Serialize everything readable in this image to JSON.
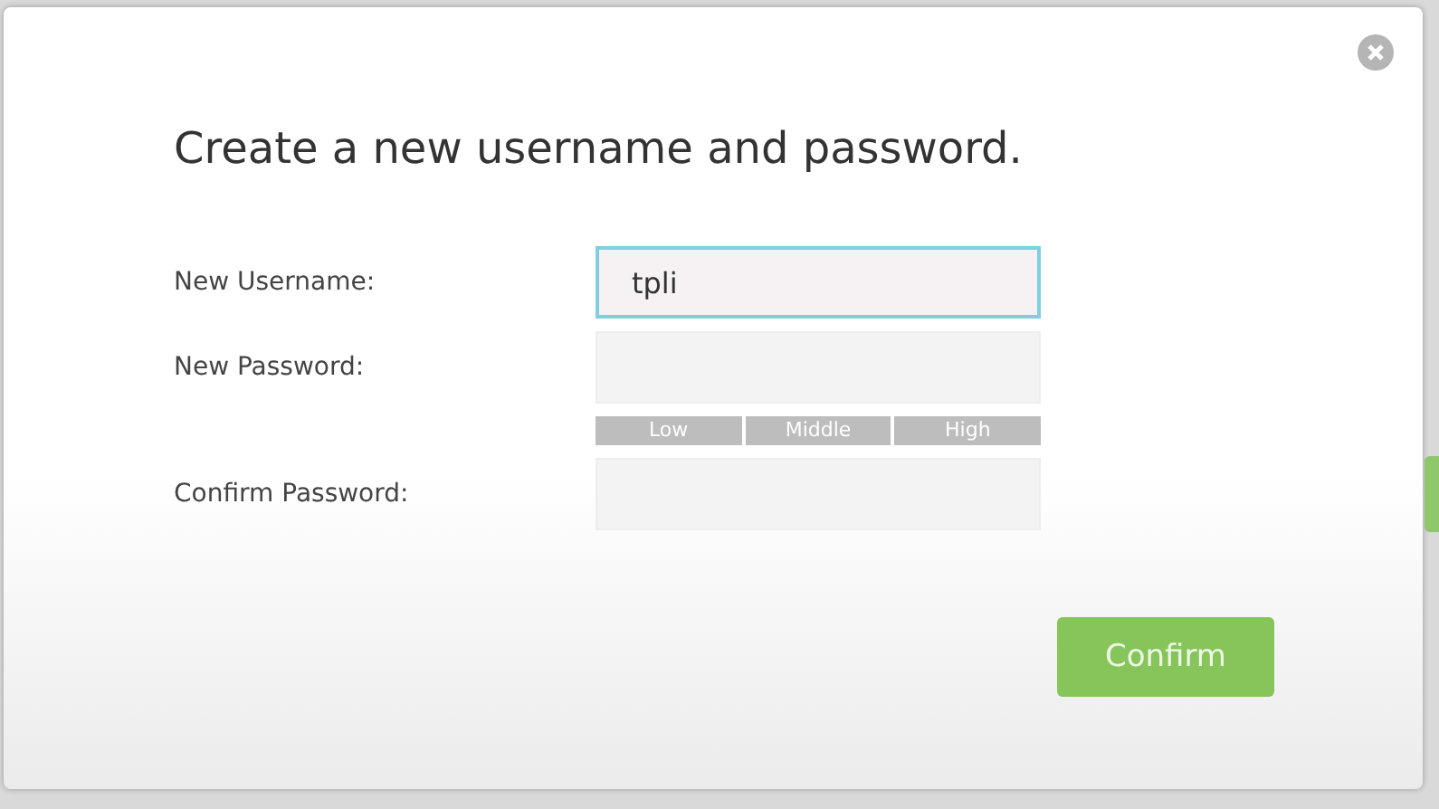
{
  "dialog": {
    "title": "Create a new username and password.",
    "fields": [
      {
        "label": "New Username:",
        "value": "tpli",
        "focused": true
      },
      {
        "label": "New Password:",
        "focused": false,
        "strength_levels": [
          "Low",
          "Middle",
          "High"
        ]
      },
      {
        "label": "Confirm Password:",
        "focused": false
      }
    ],
    "button": "Confirm"
  }
}
